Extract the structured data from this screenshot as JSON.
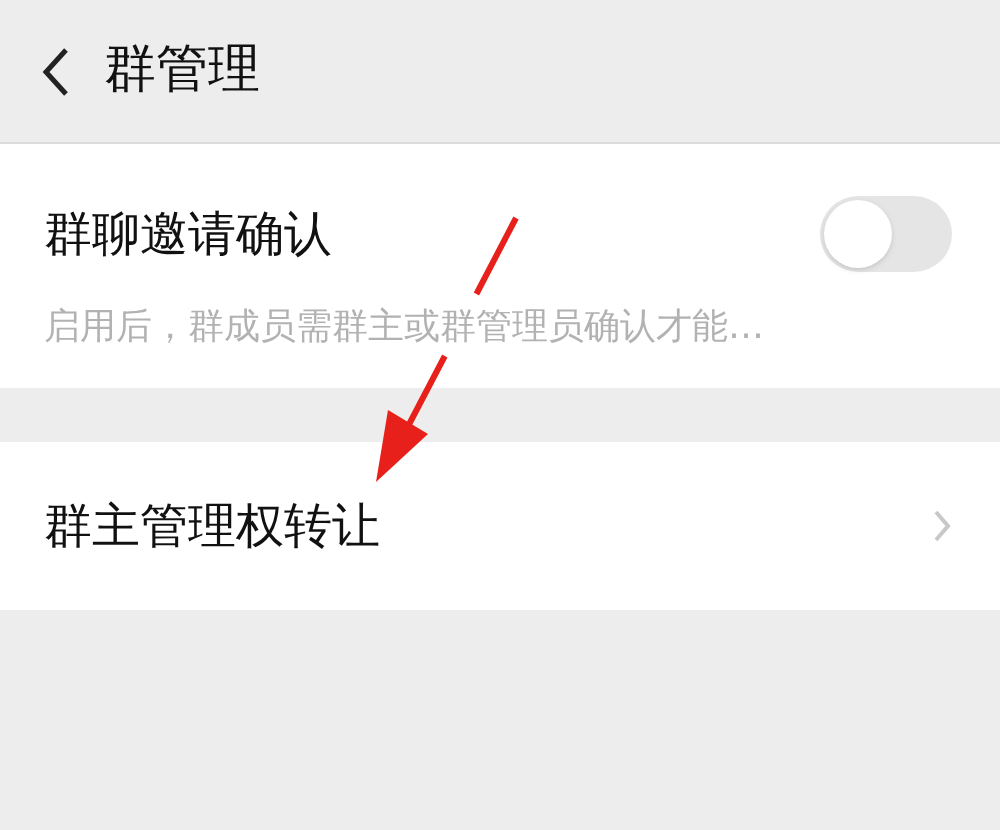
{
  "header": {
    "title": "群管理"
  },
  "settings": [
    {
      "kind": "toggle",
      "label": "群聊邀请确认",
      "description": "启用后，群成员需群主或群管理员确认才能…",
      "on": false
    },
    {
      "kind": "link",
      "label": "群主管理权转让"
    }
  ]
}
